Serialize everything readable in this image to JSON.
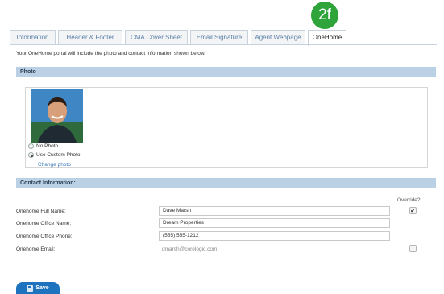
{
  "step_badge": "2f",
  "tabs": [
    {
      "label": "Information"
    },
    {
      "label": "Header & Footer"
    },
    {
      "label": "CMA Cover Sheet"
    },
    {
      "label": "Email Signature"
    },
    {
      "label": "Agent Webpage"
    },
    {
      "label": "OneHome",
      "active": true
    }
  ],
  "intro_text": "Your OneHome portal will include the photo and contact information shown below.",
  "photo_section": {
    "title": "Photo",
    "options": [
      {
        "label": "No Photo",
        "checked": false
      },
      {
        "label": "Use Custom Photo",
        "checked": true
      }
    ],
    "change_photo_link": "Change photo"
  },
  "contact_section": {
    "title": "Contact Information:",
    "override_label": "Override?",
    "fields": [
      {
        "label": "Onehome Full Name:",
        "value": "Dave Marsh",
        "override": true
      },
      {
        "label": "Onehome Office Name:",
        "value": "Dream Properties"
      },
      {
        "label": "Onehome Office Phone:",
        "value": "(555) 555-1212"
      },
      {
        "label": "Onehome Email:",
        "value": "dmarsh@corelogic.com",
        "override": false
      }
    ]
  },
  "save_button": "Save",
  "colors": {
    "accent": "#1e73be",
    "section_bar": "#bad1e5",
    "badge": "#2ea43a"
  }
}
